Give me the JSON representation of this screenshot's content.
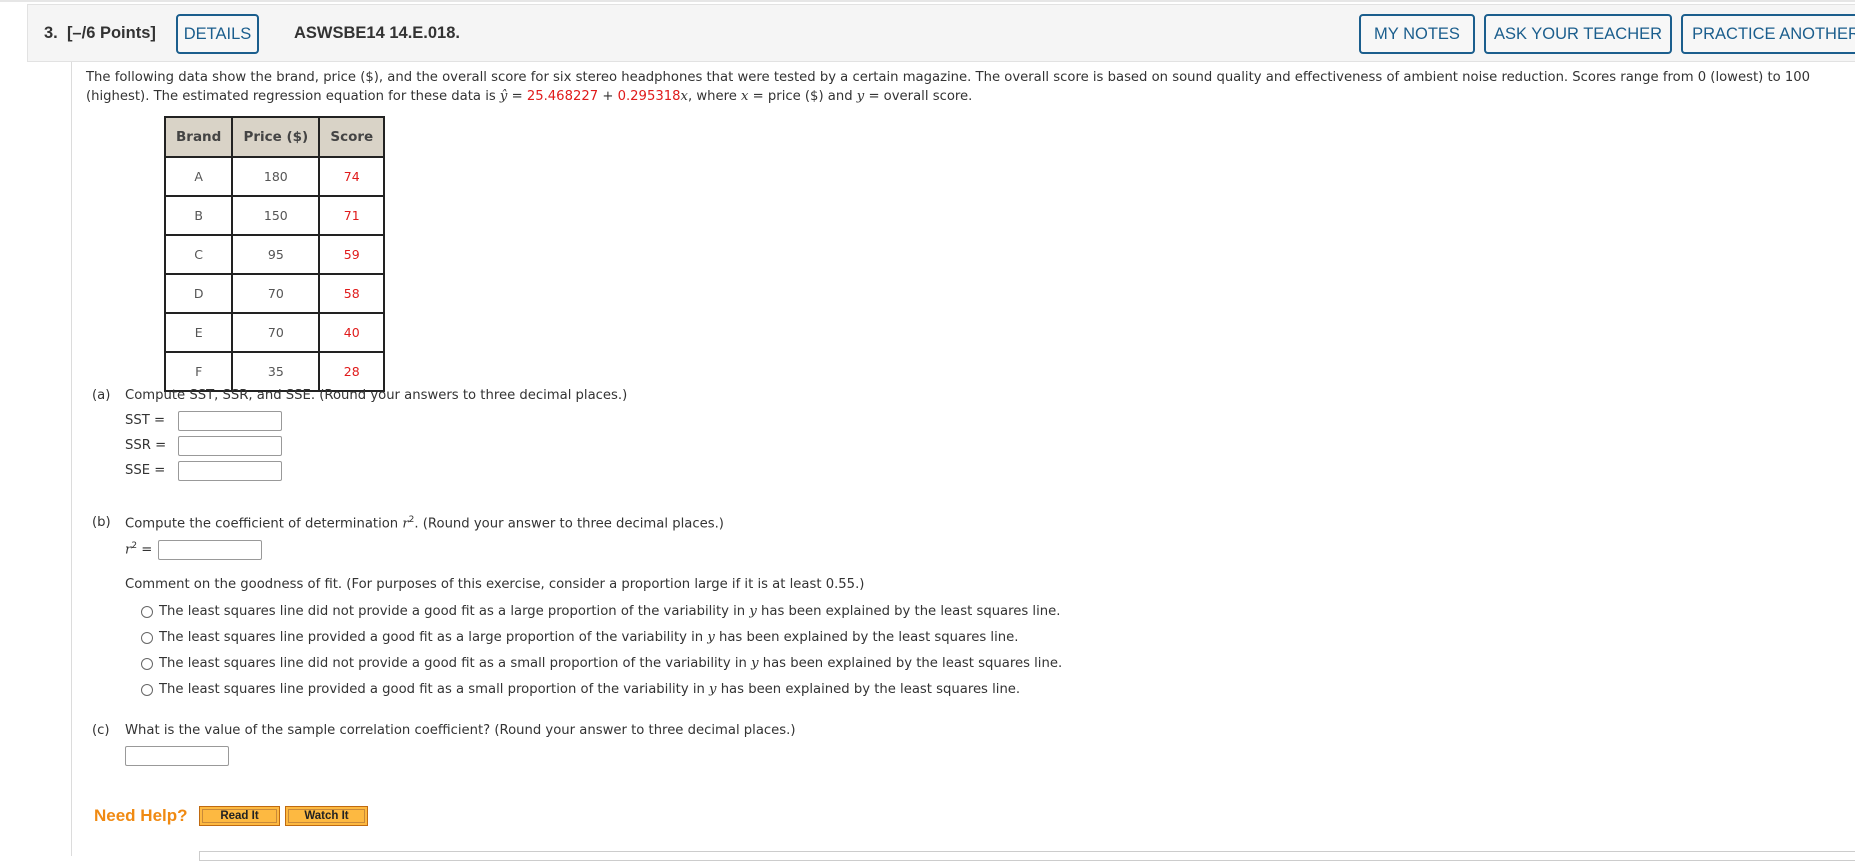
{
  "header": {
    "question_number": "3.",
    "points": "[–/6 Points]",
    "details_button": "DETAILS",
    "question_code": "ASWSBE14 14.E.018.",
    "my_notes_button": "MY NOTES",
    "ask_teacher_button": "ASK YOUR TEACHER",
    "practice_another_button": "PRACTICE ANOTHER"
  },
  "intro": {
    "line1": "The following data show the brand, price ($), and the overall score for six stereo headphones that were tested by a certain magazine. The overall score is based on sound quality and effectiveness of ambient noise reduction. Scores range from 0 (lowest) to 100",
    "line2_start": "(highest). The estimated regression equation for these data is ",
    "yhat": "ŷ",
    "equals": " = ",
    "intercept": "25.468227",
    "plus": " + ",
    "slope": "0.295318",
    "x_var": "x",
    "where": ", where ",
    "x_var2": "x",
    "x_def": " = price ($) and ",
    "y_var": "y",
    "y_def": " = overall score."
  },
  "table": {
    "headers": [
      "Brand",
      "Price ($)",
      "Score"
    ],
    "rows": [
      {
        "brand": "A",
        "price": "180",
        "score": "74"
      },
      {
        "brand": "B",
        "price": "150",
        "score": "71"
      },
      {
        "brand": "C",
        "price": "95",
        "score": "59"
      },
      {
        "brand": "D",
        "price": "70",
        "score": "58"
      },
      {
        "brand": "E",
        "price": "70",
        "score": "40"
      },
      {
        "brand": "F",
        "price": "35",
        "score": "28"
      }
    ]
  },
  "part_a": {
    "label": "(a)",
    "prompt": "Compute SST, SSR, and SSE. (Round your answers to three decimal places.)",
    "fields": [
      {
        "label": "SST  =",
        "value": ""
      },
      {
        "label": "SSR  =",
        "value": ""
      },
      {
        "label": "SSE  =",
        "value": ""
      }
    ]
  },
  "part_b": {
    "label": "(b)",
    "prompt_start": "Compute the coefficient of determination ",
    "r_var": "r",
    "sup": "2",
    "prompt_end": ". (Round your answer to three decimal places.)",
    "field_label_eq": " =",
    "field_value": "",
    "comment_prompt": "Comment on the goodness of fit. (For purposes of this exercise, consider a proportion large if it is at least 0.55.)",
    "options": [
      {
        "start": "The least squares line did not provide a good fit as a large proportion of the variability in ",
        "var": "y",
        "end": " has been explained by the least squares line.",
        "selected": false
      },
      {
        "start": "The least squares line provided a good fit as a large proportion of the variability in ",
        "var": "y",
        "end": " has been explained by the least squares line.",
        "selected": false
      },
      {
        "start": "The least squares line did not provide a good fit as a small proportion of the variability in ",
        "var": "y",
        "end": " has been explained by the least squares line.",
        "selected": false
      },
      {
        "start": "The least squares line provided a good fit as a small proportion of the variability in ",
        "var": "y",
        "end": " has been explained by the least squares line.",
        "selected": false
      }
    ]
  },
  "part_c": {
    "label": "(c)",
    "prompt": "What is the value of the sample correlation coefficient? (Round your answer to three decimal places.)",
    "field_value": ""
  },
  "help": {
    "label": "Need Help?",
    "read_it": "Read It",
    "watch_it": "Watch It"
  },
  "colors": {
    "accent_blue": "#1b5e8d",
    "highlight_red": "#e01b1b",
    "help_orange": "#f08a12",
    "help_button_fill": "#fdb941"
  }
}
